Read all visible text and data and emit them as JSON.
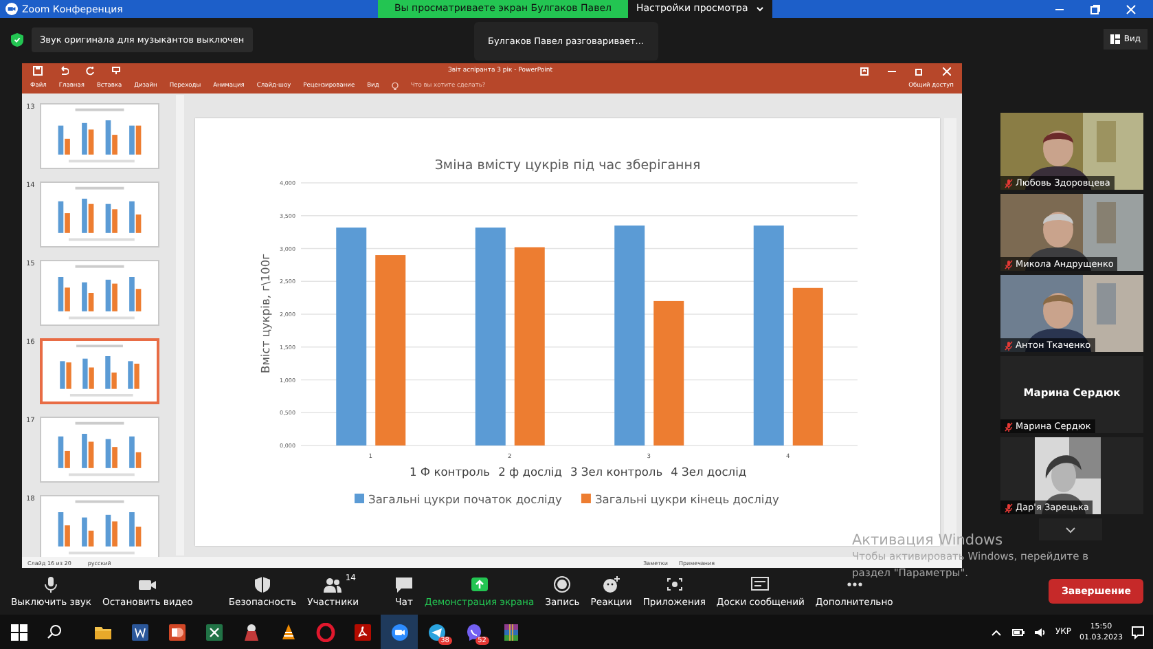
{
  "zoom_window": {
    "title": "Zoom Конференция"
  },
  "share_banner": {
    "text": "Вы просматриваете экран Булгаков Павел",
    "view_options": "Настройки просмотра"
  },
  "notice": "Звук оригинала для музыкантов выключен",
  "speaker_notice": "Булгаков Павел разговаривает...",
  "view_button": "Вид",
  "powerpoint": {
    "title": "Звіт аспіранта 3 рік - PowerPoint",
    "ribbon_tabs": [
      "Файл",
      "Главная",
      "Вставка",
      "Дизайн",
      "Переходы",
      "Анимация",
      "Слайд-шоу",
      "Рецензирование",
      "Вид"
    ],
    "tell_me": "Что вы хотите сделать?",
    "share": "Общий доступ",
    "slides": [
      {
        "number": "13",
        "selected": false
      },
      {
        "number": "14",
        "selected": false
      },
      {
        "number": "15",
        "selected": false
      },
      {
        "number": "16",
        "selected": true
      },
      {
        "number": "17",
        "selected": false
      },
      {
        "number": "18",
        "selected": false
      }
    ],
    "slide": {
      "chart_data": {
        "type": "bar",
        "title": "Зміна вмісту цукрів під час зберігання",
        "ylabel": "Вміст цукрів, г\\100г",
        "categories": [
          "1",
          "2",
          "3",
          "4"
        ],
        "series": [
          {
            "name": "Загальні цукри початок досліду",
            "color": "#5b9bd5",
            "values": [
              3.32,
              3.32,
              3.35,
              3.35
            ]
          },
          {
            "name": "Загальні цукри кінець досліду",
            "color": "#ed7d31",
            "values": [
              2.9,
              3.02,
              2.2,
              2.4
            ]
          }
        ],
        "ylim": [
          0,
          4
        ],
        "grid": true,
        "legend": true,
        "yticks": [
          {
            "value": 0,
            "label": "0,000"
          },
          {
            "value": 0.5,
            "label": "0,500"
          },
          {
            "value": 1,
            "label": "1,000"
          },
          {
            "value": 1.5,
            "label": "1,500"
          },
          {
            "value": 2,
            "label": "2,000"
          },
          {
            "value": 2.5,
            "label": "2,500"
          },
          {
            "value": 3,
            "label": "3,000"
          },
          {
            "value": 3.5,
            "label": "3,500"
          },
          {
            "value": 4,
            "label": "4,000"
          }
        ]
      },
      "caption": [
        "1 Ф контроль",
        "2 ф дослід",
        "3 Зел контроль",
        "4 Зел дослід"
      ]
    },
    "status_bar": {
      "slide": "Слайд 16 из 20",
      "language": "русский",
      "notes": "Заметки",
      "comments": "Примечания"
    }
  },
  "participants": [
    {
      "kind": "video",
      "name": "Любовь Здоровцева",
      "muted": true
    },
    {
      "kind": "video",
      "name": "Микола Андрущенко",
      "muted": true
    },
    {
      "kind": "video",
      "name": "Антон Ткаченко",
      "muted": true
    },
    {
      "kind": "name",
      "display_name": "Марина Сердюк",
      "name": "Марина Сердюк",
      "muted": true
    },
    {
      "name": "Дар'я Зарецька",
      "muted": true
    }
  ],
  "toolbar": [
    {
      "kind": "mic",
      "label": "Выключить звук",
      "highlighted": false
    },
    {
      "kind": "video",
      "label": "Остановить видео",
      "highlighted": false
    },
    {
      "kind": "shield",
      "label": "Безопасность",
      "highlighted": false
    },
    {
      "kind": "people",
      "label": "Участники",
      "count": "14",
      "highlighted": false
    },
    {
      "kind": "chat",
      "label": "Чат",
      "highlighted": false
    },
    {
      "kind": "share",
      "label": "Демонстрация экрана",
      "highlighted": true
    },
    {
      "kind": "record",
      "label": "Запись",
      "highlighted": false
    },
    {
      "kind": "reactions",
      "label": "Реакции",
      "highlighted": false
    },
    {
      "kind": "apps",
      "label": "Приложения",
      "highlighted": false
    },
    {
      "kind": "boards",
      "label": "Доски сообщений",
      "highlighted": false
    },
    {
      "kind": "more",
      "label": "Дополнительно",
      "highlighted": false
    }
  ],
  "end_button": "Завершение",
  "activation_notice": [
    "Активация Windows",
    "Чтобы активировать Windows, перейдите в",
    "раздел \"Параметры\"."
  ],
  "taskbar": {
    "apps": [
      {
        "kind": "folder",
        "selected": false
      },
      {
        "kind": "word",
        "selected": false
      },
      {
        "kind": "powerpoint",
        "selected": false
      },
      {
        "kind": "excel",
        "selected": false
      },
      {
        "kind": "app",
        "selected": false
      },
      {
        "kind": "vlc",
        "selected": false
      },
      {
        "kind": "opera",
        "selected": false
      },
      {
        "kind": "acrobat",
        "selected": false
      },
      {
        "kind": "zoom",
        "selected": true
      },
      {
        "kind": "telegram",
        "selected": false,
        "badge": "38"
      },
      {
        "kind": "viber",
        "selected": false,
        "badge": "52"
      },
      {
        "kind": "winrar",
        "selected": false
      }
    ],
    "language": "УКР",
    "time": "15:50",
    "date": "01.03.2023"
  }
}
